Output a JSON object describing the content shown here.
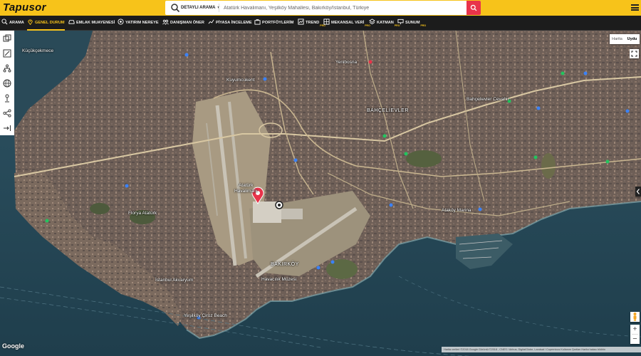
{
  "app": {
    "logo": "Tapusor"
  },
  "search": {
    "advanced_label": "DETAYLI ARAMA",
    "query": "Atatürk Havalimanı, Yeşilköy Mahallesi, Bakırköy/İstanbul, Türkiye"
  },
  "nav": [
    {
      "label": "ARAMA",
      "icon": "search-icon",
      "active": false
    },
    {
      "label": "GENEL DURUM",
      "icon": "location-pin-icon",
      "active": true
    },
    {
      "label": "EMLAK MUAYENESİ",
      "icon": "car-icon",
      "active": false
    },
    {
      "label": "YATIRIM NEREYE",
      "icon": "target-icon",
      "active": false
    },
    {
      "label": "DANIŞMAN ÖNER",
      "icon": "group-icon",
      "active": false
    },
    {
      "label": "PİYASA İNCELEME",
      "icon": "chart-icon",
      "active": false
    },
    {
      "label": "PORTFÖYLERİM",
      "icon": "briefcase-icon",
      "active": false
    },
    {
      "label": "TREND",
      "icon": "trend-icon",
      "badge": "PRO",
      "active": false
    },
    {
      "label": "MEKANSAL VERİ",
      "icon": "grid-icon",
      "badge": "PRO",
      "active": false
    },
    {
      "label": "KATMAN",
      "icon": "layers-icon",
      "badge": "PRO",
      "active": false
    },
    {
      "label": "SUNUM",
      "icon": "presentation-icon",
      "badge": "PRO",
      "active": false
    }
  ],
  "map_labels": {
    "kucukcekmece": "Küçükçekmece",
    "bahcelievler": "BAHÇELİEVLER",
    "bakirkoy": "BAKIRKÖY",
    "ataturk_airport": "Atatürk\nHavalimanı",
    "istanbul_akvaryum": "İstanbul Akvaryum",
    "havacilik_muzesi": "Havacılık Müzesi",
    "yesilkoy_beach": "Yeşilköy Çiroz Beach",
    "kuyumcukent": "Kuyumcukent",
    "yenibosna": "Yenibosna",
    "florya": "Florya Atatürk",
    "atakoy_marina": "Ataköy Marina",
    "cevahir": "Bahçelievler Cevahir"
  },
  "map_type": {
    "map": "Harita",
    "satellite": "Uydu"
  },
  "google_logo": "Google",
  "attribution": "Harita verileri ©2018 Google Görüntü ©2018 , CNES / Airbus, DigitalGlobe, Landsat / Copernicus    Kullanım Şartları    Harita hatası bildirin",
  "colors": {
    "accent": "#f7c31a",
    "navbar": "#1c1c1c",
    "pin": "#e8334a",
    "sea": "#244555"
  }
}
